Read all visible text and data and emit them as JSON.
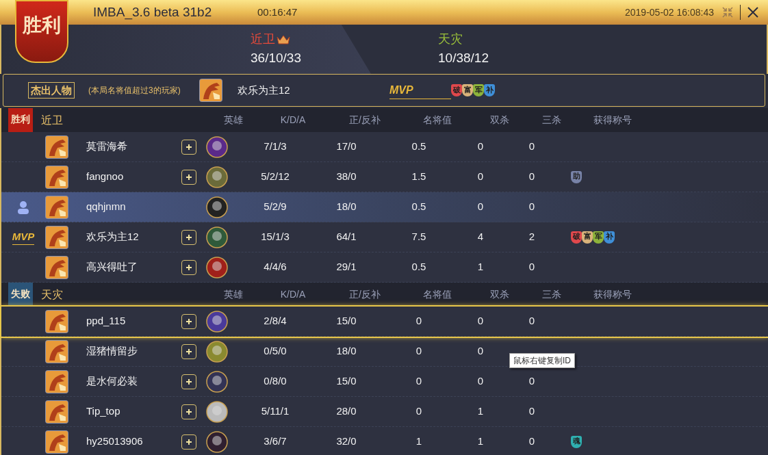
{
  "window": {
    "title": "IMBA_3.6 beta 31b2",
    "duration": "00:16:47",
    "datetime": "2019-05-02 16:08:43",
    "result_banner": "胜利"
  },
  "score": {
    "teams": [
      {
        "name": "近卫",
        "kda": "36/10/33",
        "winner": true
      },
      {
        "name": "天灾",
        "kda": "10/38/12",
        "winner": false
      }
    ]
  },
  "highlight": {
    "label": "杰出人物",
    "note": "(本局名将值超过3的玩家)",
    "player": "欢乐为主12",
    "mvp": "MVP",
    "badges": [
      {
        "text": "破",
        "color": "#e0484c"
      },
      {
        "text": "富",
        "color": "#d9b37a"
      },
      {
        "text": "军",
        "color": "#8db33a"
      },
      {
        "text": "补",
        "color": "#3f8fd8"
      }
    ]
  },
  "teams": [
    {
      "result": "胜利",
      "kind": "win",
      "name": "近卫",
      "columns": [
        "英雄",
        "K/D/A",
        "正/反补",
        "名将值",
        "双杀",
        "三杀",
        "获得称号"
      ],
      "rows": [
        {
          "name": "莫雷海希",
          "kind": "none",
          "addable": true,
          "selected": false,
          "outlined": false,
          "kda": "7/1/3",
          "cs": "17/0",
          "rating": "0.5",
          "double": "0",
          "triple": "0",
          "badges": []
        },
        {
          "name": "fangnoo",
          "kind": "none",
          "addable": true,
          "selected": false,
          "outlined": false,
          "kda": "5/2/12",
          "cs": "38/0",
          "rating": "1.5",
          "double": "0",
          "triple": "0",
          "badges": [
            {
              "text": "助",
              "color": "#7883a8"
            }
          ]
        },
        {
          "name": "qqhjnmn",
          "kind": "self",
          "addable": false,
          "selected": true,
          "outlined": false,
          "kda": "5/2/9",
          "cs": "18/0",
          "rating": "0.5",
          "double": "0",
          "triple": "0",
          "badges": []
        },
        {
          "name": "欢乐为主12",
          "kind": "mvp",
          "mvp": "MVP",
          "addable": true,
          "selected": false,
          "outlined": false,
          "kda": "15/1/3",
          "cs": "64/1",
          "rating": "7.5",
          "double": "4",
          "triple": "2",
          "badges": [
            {
              "text": "破",
              "color": "#e0484c"
            },
            {
              "text": "富",
              "color": "#d9b37a"
            },
            {
              "text": "军",
              "color": "#8db33a"
            },
            {
              "text": "补",
              "color": "#3f8fd8"
            }
          ]
        },
        {
          "name": "高兴得吐了",
          "kind": "none",
          "addable": true,
          "selected": false,
          "outlined": false,
          "kda": "4/4/6",
          "cs": "29/1",
          "rating": "0.5",
          "double": "1",
          "triple": "0",
          "badges": []
        }
      ]
    },
    {
      "result": "失败",
      "kind": "lose",
      "name": "天灾",
      "columns": [
        "英雄",
        "K/D/A",
        "正/反补",
        "名将值",
        "双杀",
        "三杀",
        "获得称号"
      ],
      "rows": [
        {
          "name": "ppd_115",
          "kind": "none",
          "addable": true,
          "selected": false,
          "outlined": true,
          "kda": "2/8/4",
          "cs": "15/0",
          "rating": "0",
          "double": "0",
          "triple": "0",
          "badges": []
        },
        {
          "name": "湿猪情留步",
          "kind": "none",
          "addable": true,
          "selected": false,
          "outlined": false,
          "kda": "0/5/0",
          "cs": "18/0",
          "rating": "0",
          "double": "0",
          "tooltip": "鼠标右键复制ID",
          "badges": []
        },
        {
          "name": "是水何必装",
          "kind": "none",
          "addable": true,
          "selected": false,
          "outlined": false,
          "kda": "0/8/0",
          "cs": "15/0",
          "rating": "0",
          "double": "0",
          "triple": "0",
          "badges": []
        },
        {
          "name": "Tip_top",
          "kind": "none",
          "addable": true,
          "selected": false,
          "outlined": false,
          "kda": "5/11/1",
          "cs": "28/0",
          "rating": "0",
          "double": "1",
          "triple": "0",
          "badges": []
        },
        {
          "name": "hy25013906",
          "kind": "none",
          "addable": true,
          "selected": false,
          "outlined": false,
          "kda": "3/6/7",
          "cs": "32/0",
          "rating": "1",
          "double": "1",
          "triple": "0",
          "badges": [
            {
              "text": "魂",
              "color": "#2fb0b0"
            }
          ]
        }
      ]
    }
  ]
}
